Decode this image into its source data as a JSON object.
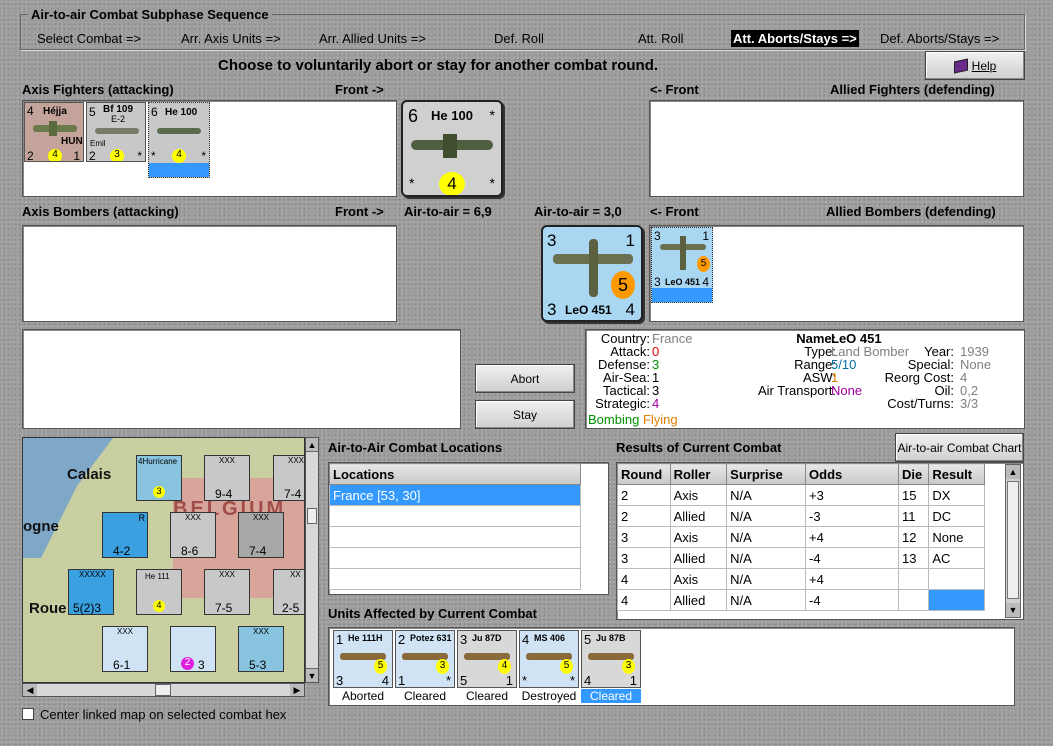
{
  "window": {
    "title": "Air-to-air Combat Subphase Sequence"
  },
  "sequence": [
    {
      "label": "Select Combat =>",
      "active": false
    },
    {
      "label": "Arr. Axis Units =>",
      "active": false
    },
    {
      "label": "Arr. Allied Units =>",
      "active": false
    },
    {
      "label": "Def. Roll",
      "active": false
    },
    {
      "label": "Att. Roll",
      "active": false
    },
    {
      "label": "Att. Aborts/Stays =>",
      "active": true
    },
    {
      "label": "Def. Aborts/Stays =>",
      "active": false
    }
  ],
  "instruction": "Choose to voluntarily abort or stay for another combat round.",
  "help_label": "Help",
  "sections": {
    "axis_fighters": "Axis Fighters (attacking)",
    "front_right": "Front ->",
    "front_left": "<- Front",
    "allied_fighters": "Allied Fighters (defending)",
    "axis_bombers": "Axis Bombers (attacking)",
    "air_axis": "Air-to-air = 6,9",
    "air_allied": "Air-to-air = 3,0",
    "allied_bombers": "Allied Bombers (defending)"
  },
  "axis_fighter_units": [
    {
      "name": "Héjja",
      "nation": "HUN",
      "top": "4",
      "bl": "2",
      "br": "1",
      "circle": "4"
    },
    {
      "name": "Bf 109",
      "sub": "E-2",
      "extra": "Emil",
      "top": "5",
      "bl": "2",
      "br": "*",
      "circle": "3"
    },
    {
      "name": "He 100",
      "top": "6",
      "bl": "*",
      "br": "*",
      "circle": "4"
    }
  ],
  "axis_big": {
    "name": "He 100",
    "top": "6",
    "bl": "*",
    "br": "*",
    "tr": "*",
    "circle": "4"
  },
  "allied_big": {
    "name": "LeO 451",
    "tl": "3",
    "tr": "1",
    "bl": "3",
    "br": "4",
    "circle": "5"
  },
  "allied_small": {
    "name": "LeO 451",
    "tl": "3",
    "tr": "1",
    "bl": "3",
    "br": "4",
    "circle": "5"
  },
  "abort_label": "Abort",
  "stay_label": "Stay",
  "info": {
    "country_label": "Country:",
    "country": "France",
    "attack_label": "Attack:",
    "attack": "0",
    "defense_label": "Defense:",
    "defense": "3",
    "airsea_label": "Air-Sea:",
    "airsea": "1",
    "tactical_label": "Tactical:",
    "tactical": "3",
    "strategic_label": "Strategic:",
    "strategic": "4",
    "bombing": "Bombing",
    "flying": "Flying",
    "name_label": "Name:",
    "name": "LeO 451",
    "type_label": "Type:",
    "type": "Land Bomber",
    "year_label": "Year:",
    "year": "1939",
    "range_label": "Range:",
    "range": "5/10",
    "special_label": "Special:",
    "special": "None",
    "asw_label": "ASW:",
    "asw": "1",
    "reorg_label": "Reorg Cost:",
    "reorg": "4",
    "transport_label": "Air Transport:",
    "transport": "None",
    "oil_label": "Oil:",
    "oil": "0,2",
    "cost_label": "Cost/Turns:",
    "cost": "3/3",
    "colors": {
      "attack": "#e00000",
      "green": "#009000",
      "blue": "#0070a0",
      "orange": "#e08000",
      "purple": "#a000a0",
      "grey": "#808080"
    }
  },
  "map": {
    "labels": {
      "calais": "Calais",
      "ogne": "ogne",
      "roue": "Roue",
      "belgium": "BELGIUM"
    },
    "units": [
      {
        "id": "hurricane",
        "text": "4Hurricane",
        "circle": "3"
      },
      {
        "id": "u1",
        "top": "XXX",
        "value": "9-4"
      },
      {
        "id": "u2",
        "top": "XXX",
        "value": "7-4"
      },
      {
        "id": "u3",
        "top": "R",
        "value": "4-2"
      },
      {
        "id": "u4",
        "top": "XXX",
        "value": "8-6"
      },
      {
        "id": "u5",
        "top": "XXX",
        "value": "7-4"
      },
      {
        "id": "u6",
        "top": "XXXXX",
        "value": "5(2)3"
      },
      {
        "id": "u7",
        "text": "He 111",
        "circle": "4"
      },
      {
        "id": "u8",
        "top": "XXX",
        "value": "7-5"
      },
      {
        "id": "u9",
        "top": "XX",
        "value": "2-5"
      },
      {
        "id": "u10",
        "top": "XXX",
        "value": "6-1"
      },
      {
        "id": "u11",
        "circle": "2",
        "value": "3"
      },
      {
        "id": "u12",
        "top": "XXX",
        "value": "5-3"
      }
    ]
  },
  "center_map_label": "Center linked map on selected combat hex",
  "locations_title": "Air-to-Air Combat Locations",
  "locations_header": "Locations",
  "locations": [
    "France [53, 30]",
    "",
    "",
    "",
    "",
    ""
  ],
  "results_title": "Results of Current Combat",
  "chart_button": "Air-to-air Combat Chart",
  "results_headers": [
    "Round",
    "Roller",
    "Surprise",
    "Odds",
    "Die",
    "Result"
  ],
  "results_rows": [
    [
      "2",
      "Axis",
      "N/A",
      "+3",
      "15",
      "DX"
    ],
    [
      "2",
      "Allied",
      "N/A",
      "-3",
      "11",
      "DC"
    ],
    [
      "3",
      "Axis",
      "N/A",
      "+4",
      "12",
      "None"
    ],
    [
      "3",
      "Allied",
      "N/A",
      "-4",
      "13",
      "AC"
    ],
    [
      "4",
      "Axis",
      "N/A",
      "+4",
      "",
      ""
    ],
    [
      "4",
      "Allied",
      "N/A",
      "-4",
      "",
      ""
    ]
  ],
  "affected_title": "Units Affected by Current Combat",
  "affected_units": [
    {
      "name": "He 111H",
      "tl": "1",
      "bl": "3",
      "br": "4",
      "circle": "5",
      "status": "Aborted",
      "bg": "#cfe3f4",
      "selected": false
    },
    {
      "name": "Potez 631",
      "tl": "2",
      "bl": "1",
      "br": "*",
      "circle": "3",
      "status": "Cleared",
      "bg": "#cfe3f4",
      "selected": false
    },
    {
      "name": "Ju 87D",
      "tl": "3",
      "bl": "5",
      "br": "1",
      "circle": "4",
      "status": "Cleared",
      "bg": "#d8d8d8",
      "selected": false
    },
    {
      "name": "MS 406",
      "tl": "4",
      "bl": "*",
      "br": "*",
      "circle": "5",
      "status": "Destroyed",
      "bg": "#cfe3f4",
      "selected": false
    },
    {
      "name": "Ju 87B",
      "tl": "5",
      "bl": "4",
      "br": "1",
      "circle": "3",
      "status": "Cleared",
      "bg": "#d8d8d8",
      "selected": true
    }
  ]
}
